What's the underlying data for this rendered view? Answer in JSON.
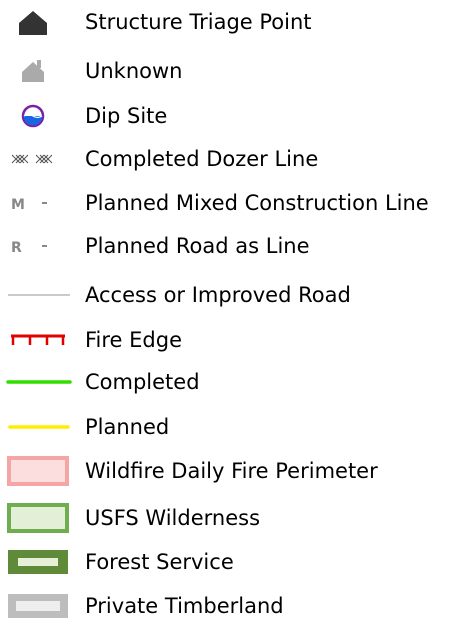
{
  "legend": {
    "items": [
      {
        "label": "Structure Triage Point",
        "symbol": "structure-house-icon",
        "color": "#333333"
      },
      {
        "label": "Unknown",
        "symbol": "unknown-house-icon",
        "color": "#aaaaaa"
      },
      {
        "label": "Dip Site",
        "symbol": "dip-site-icon",
        "color": "#7a1fa8"
      },
      {
        "label": "Completed Dozer Line",
        "symbol": "dozer-line-icon",
        "color": "#555555"
      },
      {
        "label": "Planned Mixed Construction Line",
        "symbol": "mixed-line-icon",
        "letter": "M",
        "color": "#888888"
      },
      {
        "label": "Planned Road as Line",
        "symbol": "road-line-icon",
        "letter": "R",
        "color": "#888888"
      },
      {
        "label": "Access or Improved Road",
        "symbol": "road-line-icon",
        "color": "#aaaaaa"
      },
      {
        "label": "Fire Edge",
        "symbol": "fire-edge-icon",
        "color": "#e00000"
      },
      {
        "label": "Completed",
        "symbol": "completed-line-icon",
        "color": "#33dd00"
      },
      {
        "label": "Planned",
        "symbol": "planned-line-icon",
        "color": "#ffee00"
      },
      {
        "label": "Wildfire Daily Fire Perimeter",
        "symbol": "perimeter-swatch-icon",
        "fill": "#fddede",
        "stroke": "#f4a6a6"
      },
      {
        "label": "USFS Wilderness",
        "symbol": "wilderness-swatch-icon",
        "fill": "#e3efd6",
        "stroke": "#6fae4f"
      },
      {
        "label": "Forest Service",
        "symbol": "forest-service-swatch-icon",
        "fill": "#e7efd7",
        "stroke": "#5f8a3a"
      },
      {
        "label": "Private Timberland",
        "symbol": "timberland-swatch-icon",
        "fill": "#eeeeee",
        "stroke": "#bdbdbd"
      }
    ]
  }
}
